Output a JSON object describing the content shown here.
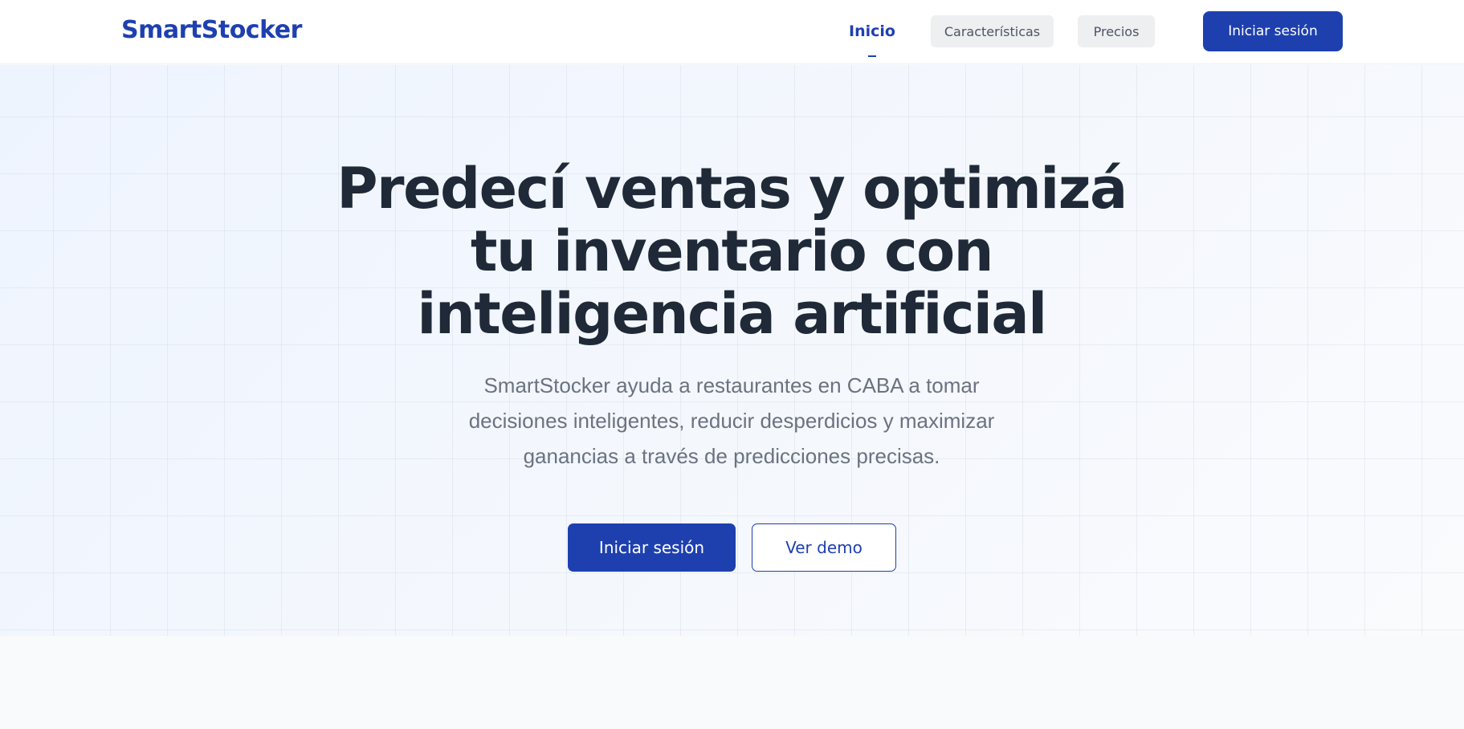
{
  "brand": {
    "name": "SmartStocker",
    "color": "#1e40af"
  },
  "nav": {
    "items": [
      {
        "label": "Inicio",
        "active": true
      },
      {
        "label": "Características",
        "active": false
      },
      {
        "label": "Precios",
        "active": false
      }
    ],
    "login_label": "Iniciar sesión"
  },
  "hero": {
    "title_lines": [
      "Predecí ventas y optimizá",
      "tu inventario con",
      "inteligencia artificial"
    ],
    "subtitle_lines": [
      "SmartStocker ayuda a restaurantes en CABA a tomar",
      "decisiones inteligentes, reducir desperdicios y maximizar",
      "ganancias a través de predicciones precisas."
    ],
    "primary_cta": "Iniciar sesión",
    "secondary_cta": "Ver demo"
  },
  "colors": {
    "accent": "#1e40af",
    "heading": "#1f2937",
    "body_text": "#6b7280",
    "background": "#f8fafc"
  }
}
